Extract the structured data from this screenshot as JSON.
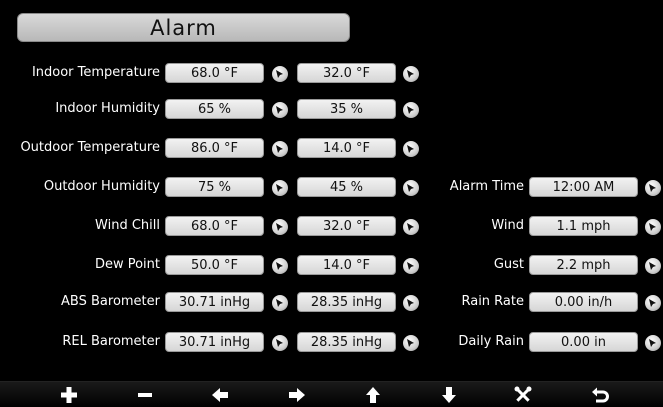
{
  "header": {
    "title": "Alarm"
  },
  "rows_left": [
    {
      "label": "Indoor Temperature",
      "high": "68.0 °F",
      "low": "32.0 °F"
    },
    {
      "label": "Indoor Humidity",
      "high": "65 %",
      "low": "35 %"
    },
    {
      "label": "Outdoor Temperature",
      "high": "86.0 °F",
      "low": "14.0 °F"
    },
    {
      "label": "Outdoor Humidity",
      "high": "75 %",
      "low": "45 %"
    },
    {
      "label": "Wind Chill",
      "high": "68.0 °F",
      "low": "32.0 °F"
    },
    {
      "label": "Dew Point",
      "high": "50.0 °F",
      "low": "14.0 °F"
    },
    {
      "label": "ABS Barometer",
      "high": "30.71 inHg",
      "low": "28.35 inHg"
    },
    {
      "label": "REL Barometer",
      "high": "30.71 inHg",
      "low": "28.35 inHg"
    }
  ],
  "rows_right": [
    {
      "label": "Alarm Time",
      "value": "12:00 AM"
    },
    {
      "label": "Wind",
      "value": "1.1 mph"
    },
    {
      "label": "Gust",
      "value": "2.2 mph"
    },
    {
      "label": "Rain Rate",
      "value": "0.00 in/h"
    },
    {
      "label": "Daily Rain",
      "value": "0.00 in"
    }
  ],
  "toolbar": {
    "buttons": [
      "plus-icon",
      "minus-icon",
      "arrow-left-icon",
      "arrow-right-icon",
      "arrow-up-icon",
      "arrow-down-icon",
      "tools-icon",
      "back-icon"
    ]
  }
}
